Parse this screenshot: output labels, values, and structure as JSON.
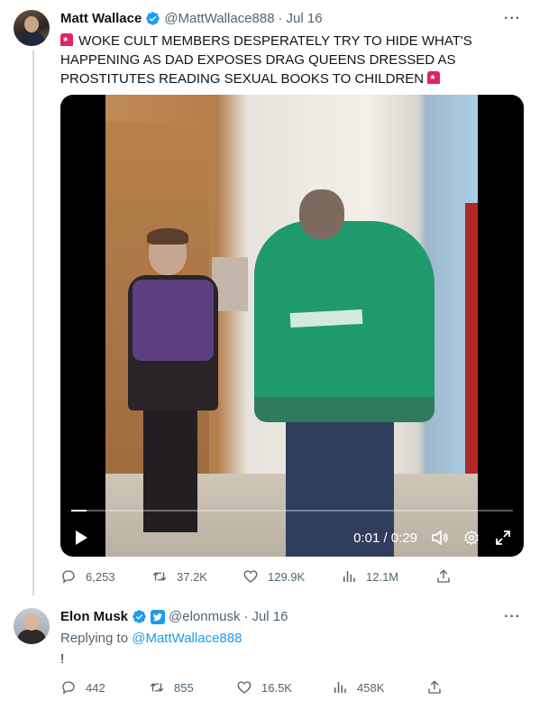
{
  "tweet1": {
    "name": "Matt Wallace",
    "handle": "@MattWallace888",
    "dot": "·",
    "date": "Jul 16",
    "more_label": "···",
    "text": "WOKE CULT MEMBERS DESPERATELY TRY TO HIDE WHAT'S HAPPENING AS DAD EXPOSES DRAG QUEENS DRESSED AS PROSTITUTES READING SEXUAL BOOKS TO CHILDREN",
    "siren_icon": "police-light-emoji",
    "video": {
      "time": "0:01 / 0:29",
      "progress": 0.035,
      "icons": [
        "play-icon",
        "volume-icon",
        "settings-icon",
        "fullscreen-icon"
      ]
    },
    "actions": {
      "replies": "6,253",
      "retweets": "37.2K",
      "likes": "129.9K",
      "views": "12.1M"
    }
  },
  "tweet2": {
    "name": "Elon Musk",
    "handle": "@elonmusk",
    "dot": "·",
    "date": "Jul 16",
    "more_label": "···",
    "replying_prefix": "Replying to",
    "replying_to": "@MattWallace888",
    "text": "!",
    "actions": {
      "replies": "442",
      "retweets": "855",
      "likes": "16.5K",
      "views": "458K"
    }
  },
  "colors": {
    "accent": "#1d9bf0",
    "text": "#0f1419",
    "muted": "#536471",
    "thread_line": "#cfd9de"
  }
}
